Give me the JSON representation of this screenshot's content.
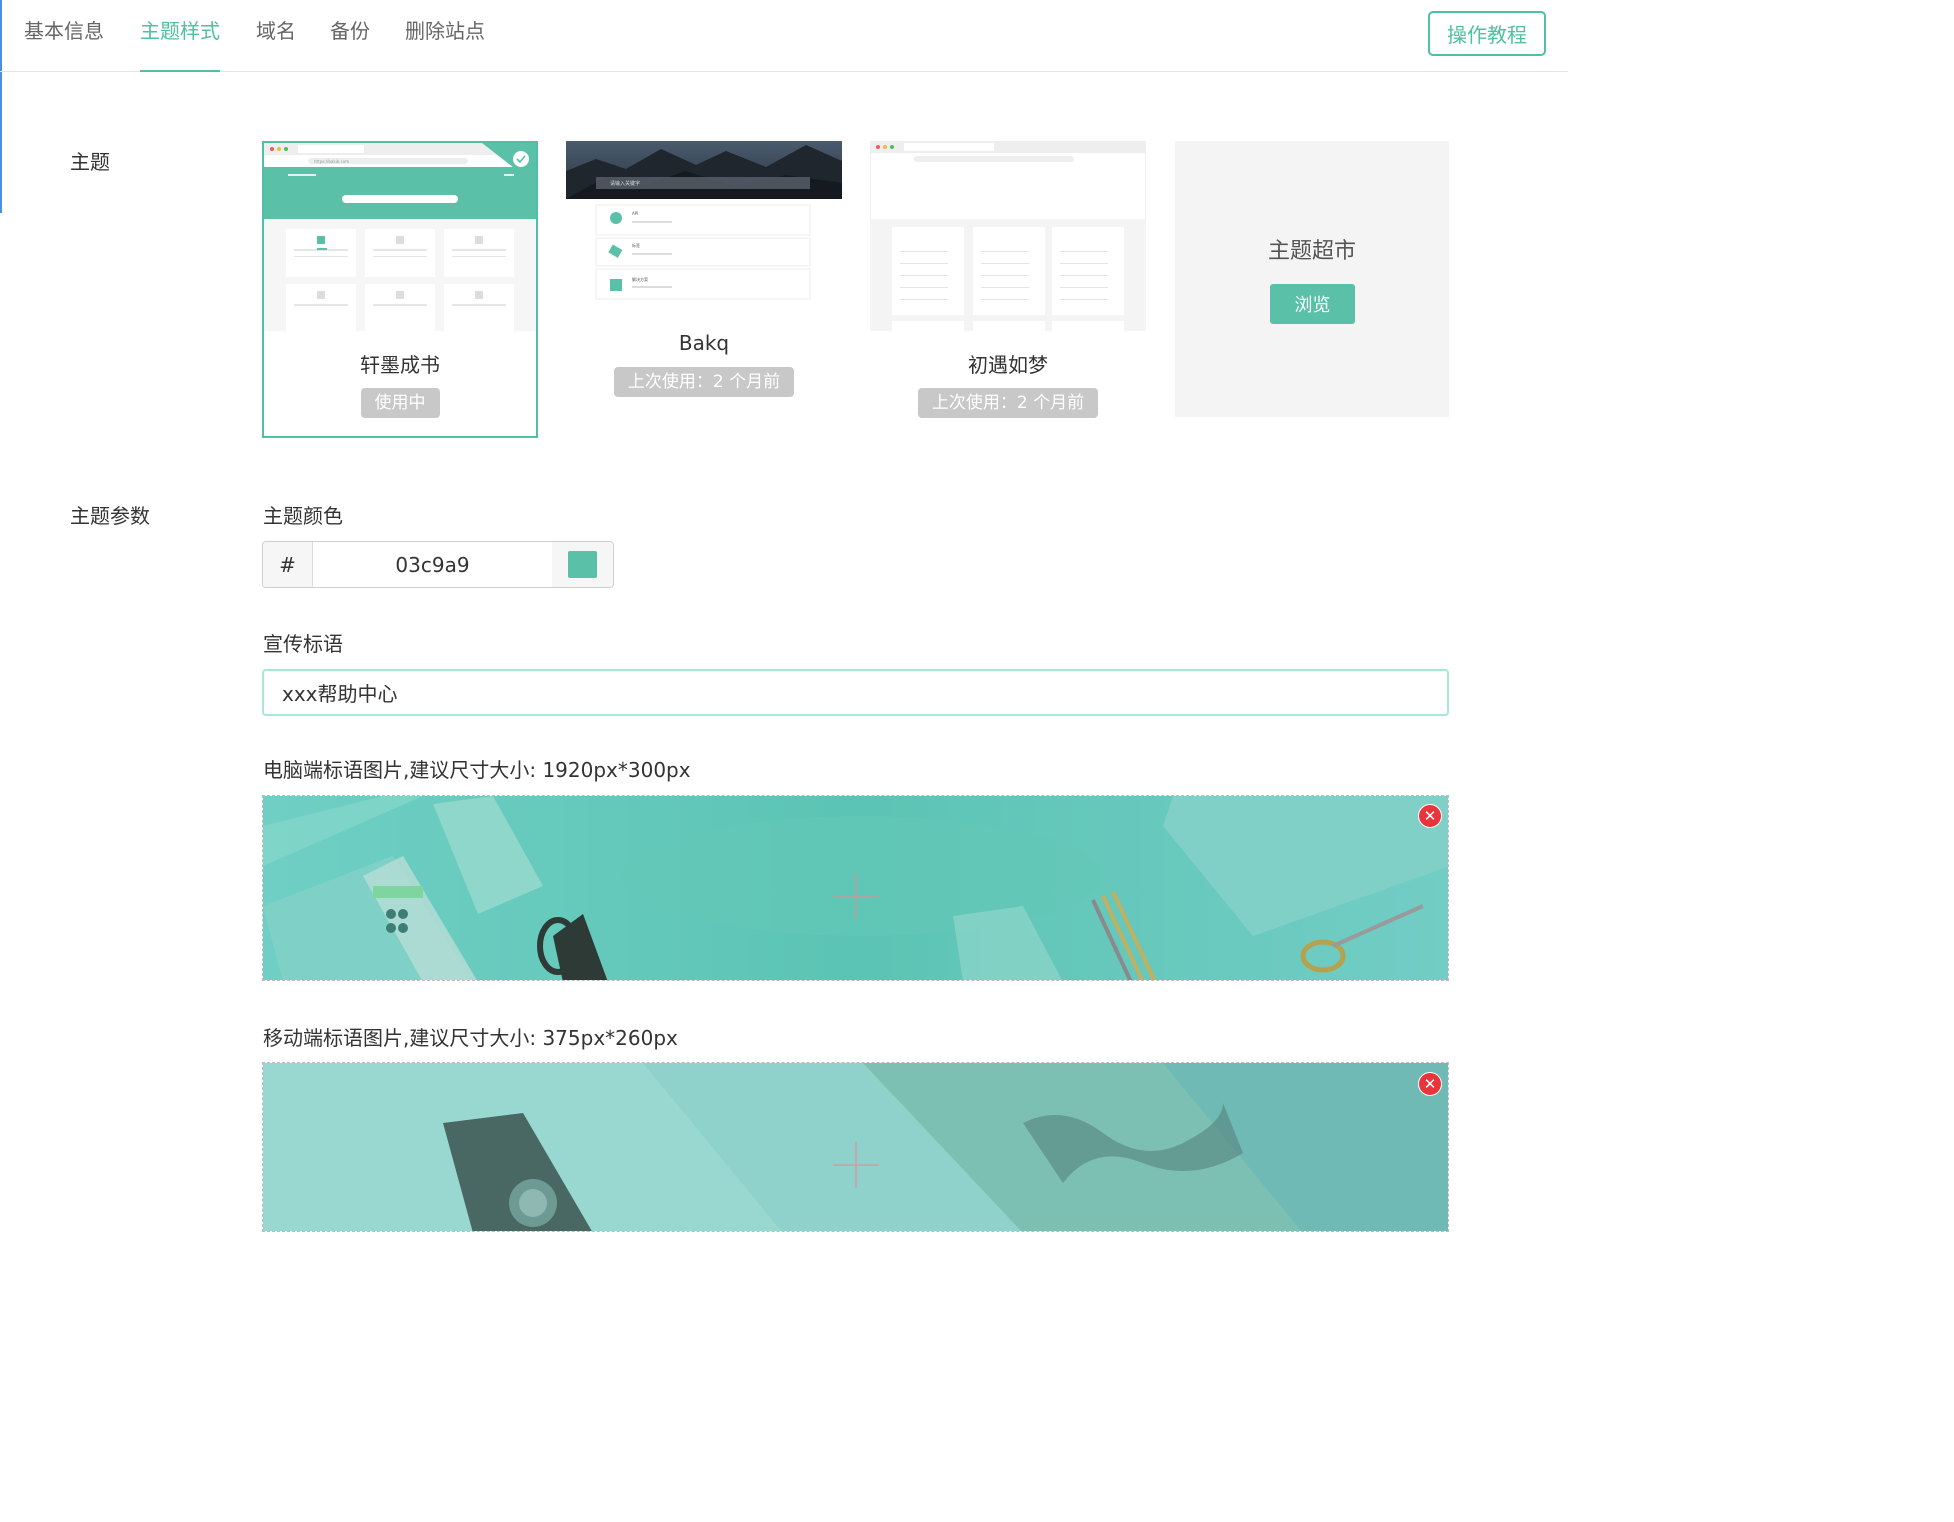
{
  "tabs": [
    {
      "label": "基本信息"
    },
    {
      "label": "主题样式"
    },
    {
      "label": "域名"
    },
    {
      "label": "备份"
    },
    {
      "label": "删除站点"
    }
  ],
  "tutorial_label": "操作教程",
  "section_theme_label": "主题",
  "section_params_label": "主题参数",
  "themes": [
    {
      "name": "轩墨成书",
      "status": "使用中"
    },
    {
      "name": "Bakq",
      "status": "上次使用：2 个月前"
    },
    {
      "name": "初遇如梦",
      "status": "上次使用：2 个月前"
    }
  ],
  "market": {
    "title": "主题超市",
    "browse_label": "浏览"
  },
  "theme_color": {
    "label": "主题颜色",
    "prefix": "#",
    "value": "03c9a9",
    "swatch": "#5bc0a8"
  },
  "slogan": {
    "label": "宣传标语",
    "value": "xxx帮助中心"
  },
  "pc_image": {
    "label": "电脑端标语图片,建议尺寸大小: 1920px*300px"
  },
  "mobile_image": {
    "label": "移动端标语图片,建议尺寸大小: 375px*260px"
  },
  "thumb_texts": {
    "url": "https://bakib.com",
    "search_placeholder": "请输入关键字",
    "item_api": "API",
    "item_tags": "标签",
    "item_map": "解决方案"
  },
  "colors": {
    "accent": "#4fc0a0",
    "badge": "#c8c8c8"
  }
}
